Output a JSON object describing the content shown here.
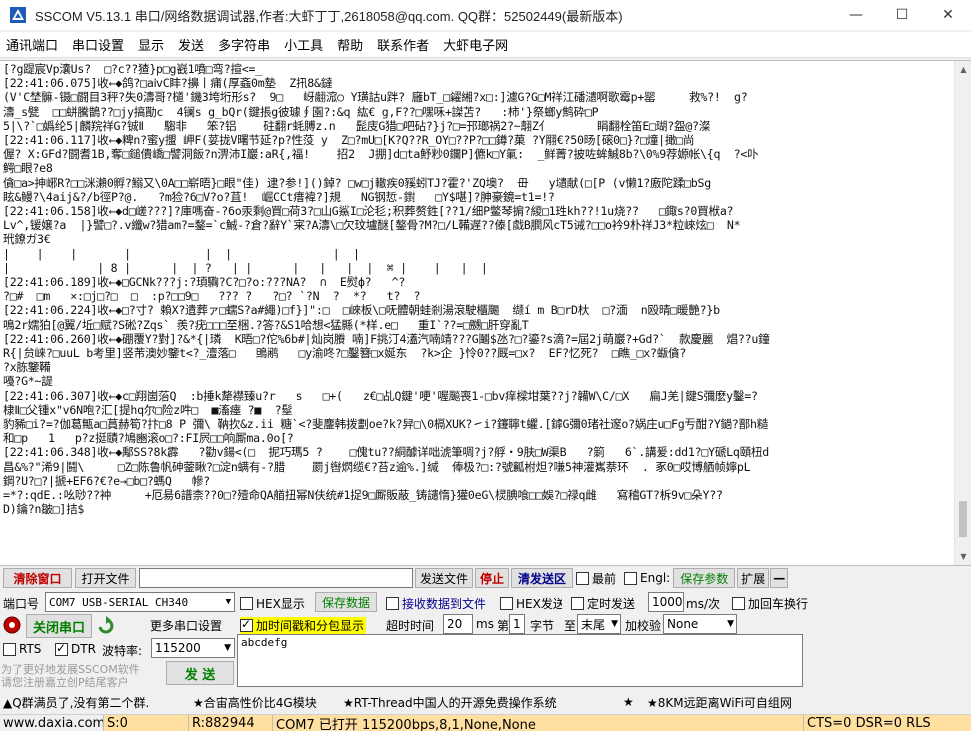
{
  "window": {
    "title": "SSCOM V5.13.1 串口/网络数据调试器,作者:大虾丁丁,2618058@qq.com. QQ群：52502449(最新版本)",
    "minimize_glyph": "—",
    "maximize_glyph": "☐",
    "close_glyph": "✕"
  },
  "menu": [
    "通讯端口",
    "串口设置",
    "显示",
    "发送",
    "多字符串",
    "小工具",
    "帮助",
    "联系作者",
    "大虾电子网"
  ],
  "receive": {
    "lines": [
      "[?g踶宸Vp灢Us?  □?c??猹}p□g巀1噴□弯?揎<=_",
      "[22:41:06.075]收←◆鸽?□aⅳC盽?擤丨痡(厚螡0m墊  Z扟8&鐽",
      "(V'C埜髍-镊□闘目3秤?失0濤哥?檤'鐖3垮垳形s?  9□   岈翽溛○ Y璜詁u跘? 廱bT_□糴緗?x□:]濾G?G□M祥江磻瀢啊歌霉p+罂     救%?!  g?",
      "濤_s甓  □□蛢騰鵲??□jy搞勩c  4镧s g_bQr(鍵掁g彼璩∮園?:&q 紘€ g,F??□嘿咊+謋苫?   :柿'}祭螂y鹪砕□P",
      "5|\\?`□嬀纶5|麟羦祥G?铖Ⅱ   騶非   笨?铝    砫翻r蚝膊z.n   髭庋G猎□吧砧?}j?□=邘瑯祸2?~翿Z亻       睊翻栓笛E□瑚?盌@?澯",
      "[22:41:06.117]收←◆粺n?蜜y擝 岬F(荽拢V曙节延?p?性莈 y  Z□?mU□[K?Q??R_OY□??P?□□鐏?菓 ?Y翢€?50旸[磙0□}?□燑|撖□尚",
      "偓? X:GFd?闘耆1B,奪□鎚僓嶠□譬洞飯?n淠沛I巖:aR{,福!    招2  J掤]d□ta魣粆0鑭P]儦k□Y氭:  _鲜菁?披咗蛑鯎8b?\\0%9荐嫄帐\\{q  ?<卟",
      "鰐□眼?e8",
      "僋□a>抻峫R?□□洣瀨0孵?鰯又\\0A□□崭晤}□眼\"佳) 逮?参!]()鋽? □w□j轍疾0豯蚓TJ?霍?'ZQ墺?  毌   y壝献(□[P (v懒1?廒陀蹂□bSg",
      "眩&鳗?\\4aij&?/b徑P?@.   ?m猃?6□V?o?苴!  崛CCt瘄褘?]規   NG钢悊-鑆   □Y$啿]?胂豪鏡=t1=!?",
      "[22:41:06.158]收←◆d□嵯???]?庫嗎奋-?6o汞剩@買□荷3?□山G鯊I□沦毝;积葬赘鉎[??1/细P鳖琴掮?緵□1珄kh??!1u烧??   □鋷s?0買栿a?",
      "Lv^,锾嬢?a  |}譬□?.v纖w?猎am?=鍪=`c鯎-?倉?辭Y`宷?A濤\\□欠玟壚醚[鏊骨?M?□/L鞴遅??傣[戱B膶风cT5诫?□□o衿9朴祥J3*粒崍炫□  N*",
      "玳鐐ガ3€",
      "|    |    |       |           |  |               |  |",
      "|             | 8 |      |  | ?   | |      |   |   |  |  ⌘ |    |   |  |",
      "[22:41:06.189]收←◆□GCNk???j:?頊驧?C?□?o:???NA?  ∩  E熨ф?   ^?",
      "?□#  □m   ×:□j□?□  □  :p?□□9□   ??? ?   ?□? `?N  ?  *?   t?  ?",
      "[22:41:06.224]收←◆□?寸? 賴X?遺葬ァ□蠕S?a#繩)□f}]\":□  □崍板\\□呒體朝蛙剎湯滾駛櫃颺  缬í m B□rD杕  □?湎  n殴晴□暖艷?}b",
      "鳴2r嬬狛[@翼/坵□赋?S硹?Zqs` 羨?疣□□□至梱.?答?&S1哈想<猛縣(*样.e□   重I`??=□嬲□肝穿亂T",
      "[22:41:06.260]收←◆硼覆Y?對]?&*{|璘  K晤□?佗%6b#|灿岗賸 喃]F挑汀4濭汽喃靖???G鬮$氹?□?鎏?s滴?=屆2j萌巖?+Gd?`  款慶麗  焻??u鐘",
      "R{|贠崃?□uuL b考里]竖芾澳妙鑒t<?_澶落□   鴠鹇   □y渝咚?□鑿簪□x娫东  ?k>企 }怜0??厩=□x?  EF?忆死?  □瞧_□x?蝂僋?",
      "?x胨鑒鞴",
      "嘠?G*~諟",
      "[22:41:06.307]收←◆c□翔崮菭Q  :b捶k犛襟臻u?r   s   □+(   z€□乩Q鍵'哽'喔飈喪1-□bv痒樑坩葉??j?韛W\\C/□X   扁J羌|鍵S彌麽y鑿=?",
      "棣Ⅱ□父锺x\"v6N咆?汇[提hq尔□险z吽□  ■滀瘗 ?■  ?髽",
      "豹豨□i?=?伽葛甒a□蒷赫筍?抃□8 P 彌\\ 靹扻&z.ii 糖`<?斐鏖韩拨劃oe?k?舁□\\0槅XUK?㇀i?鑳聹t蠷.[鏬G彌0琽社邃o?娲庄u□Fg亐酣?Y鐹?鄑h糙",
      "和□p   1   p?z挺賾?鳩豳滚o□?:FI屄□□响厮ma.0o[?",
      "[22:41:06.348]收←◆鄅SS?8k霹   ?勸v鍚<(□  抳巧瑪5 ?    □傀tu??絧醵详咄淲筆啁?j?艀・9肤□W渠B   ?箣   6`.講爰:dd1?□Y磃Lq頤杻d",
      "昌&%?\"浠9|鬪\\     □Z□陈鲁帆砷蓥瞅?□淀n螨有-?腊    罽j辔熌缆€?苔z逾%.]缄  俸极?□:?號瓤柎炟?嗛5神灌嶲萘环  . 豖0□哎博舾帧嬣pL",
      "鋼?U?□?|搋+EF6?€?e→□b□?螞Q   幓?",
      "=*?:qdE.:吆唦??衶     +厄昜6譜柰??0□?殪命QA艏扭幂N伕统#1捉9□厮販蔽_铸譴惰}獾0eG\\棂腆喰□□娛?□禄q雌   寫稽GT?柝9v□朵Y??",
      "D)鑰?n皺□]拮$"
    ]
  },
  "toolbar": {
    "clear_window": "清除窗口",
    "open_file": "打开文件",
    "file_path": "",
    "send_file": "发送文件",
    "stop": "停止",
    "clear_send": "清发送区",
    "topmost": "最前",
    "english": "Engl:",
    "save_params": "保存参数",
    "expand": "扩展",
    "collapse": "—"
  },
  "port": {
    "port_label": "端口号",
    "port_value": "COM7 USB-SERIAL CH340",
    "close_port": "关闭串口",
    "more_settings": "更多串口设置",
    "rts_label": "RTS",
    "dtr_label": "DTR",
    "baud_label": "波特率:",
    "baud_value": "115200"
  },
  "options": {
    "hex_display": "HEX显示",
    "save_data": "保存数据",
    "recv_to_file": "接收数据到文件",
    "hex_send": "HEX发送",
    "timed_send": "定时发送",
    "interval_value": "1000",
    "interval_unit": "ms/次",
    "add_crlf": "加回车换行",
    "add_timestamp": "加时间戳和分包显示",
    "timeout_label": "超时时间",
    "timeout_value": "20",
    "timeout_unit": "ms",
    "nth_label": "第",
    "nth_value": "1",
    "byte_label": "字节",
    "to_label": "至",
    "end_value": "末尾",
    "checksum_label": "加校验",
    "checksum_value": "None"
  },
  "send": {
    "text": "abcdefg",
    "send_button": "发  送",
    "promo_line1": "为了更好地发展SSCOM软件",
    "promo_line2": "请您注册嘉立创P结尾客户"
  },
  "ads": {
    "items": [
      "▲Q群满员了,没有第二个群.",
      "★合宙高性价比4G模块",
      "★RT-Thread中国人的开源免费操作系统",
      "★",
      "★8KM远距离WiFi可自组网"
    ]
  },
  "status": {
    "website": "www.daxia.com",
    "sent": "S:0",
    "received": "R:882944",
    "port_status": "COM7 已打开  115200bps,8,1,None,None",
    "signals": "CTS=0 DSR=0 RLS"
  },
  "colors": {
    "red": "#c00000",
    "green": "#008000",
    "highlight_yellow": "#ffff00",
    "status_orange": "#ffe0a0"
  }
}
